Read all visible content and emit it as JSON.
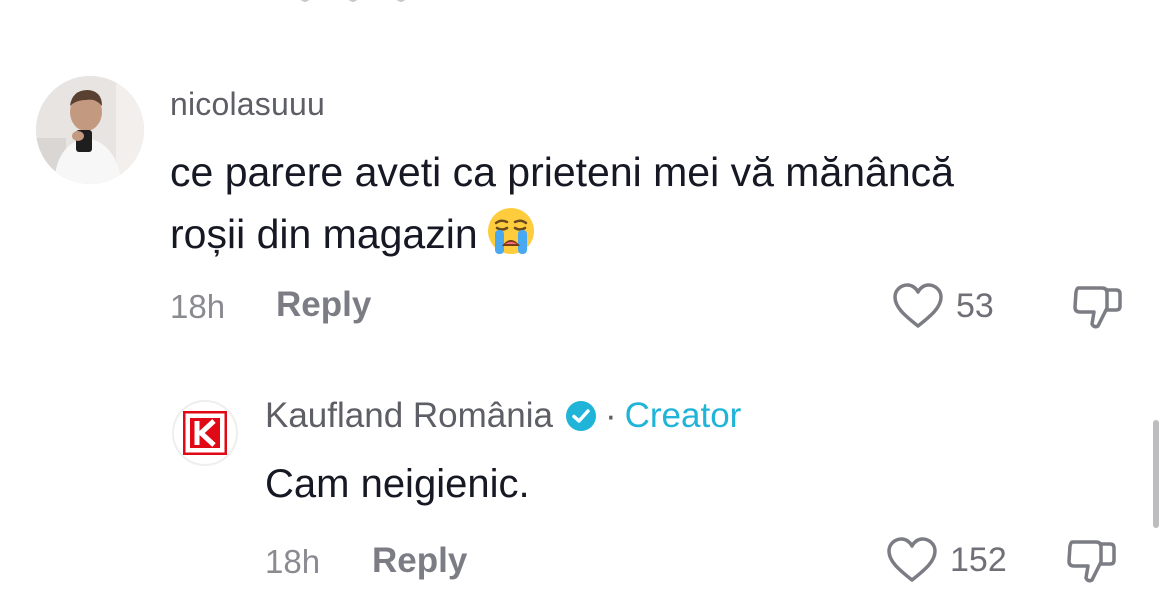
{
  "comments": [
    {
      "username": "nicolasuuu",
      "text_line1": "ce parere aveti ca prieteni mei vă mănâncă",
      "text_line2": "roșii din magazin",
      "emoji": "loudly-crying-face",
      "time": "18h",
      "reply_label": "Reply",
      "likes": "53"
    },
    {
      "username": "Kaufland România",
      "verified": true,
      "separator": "·",
      "role_label": "Creator",
      "text": "Cam neigienic.",
      "time": "18h",
      "reply_label": "Reply",
      "likes": "152"
    }
  ],
  "colors": {
    "creator_accent": "#20b4d8",
    "kaufland_red": "#e10915",
    "muted_text": "#8a8b91"
  }
}
